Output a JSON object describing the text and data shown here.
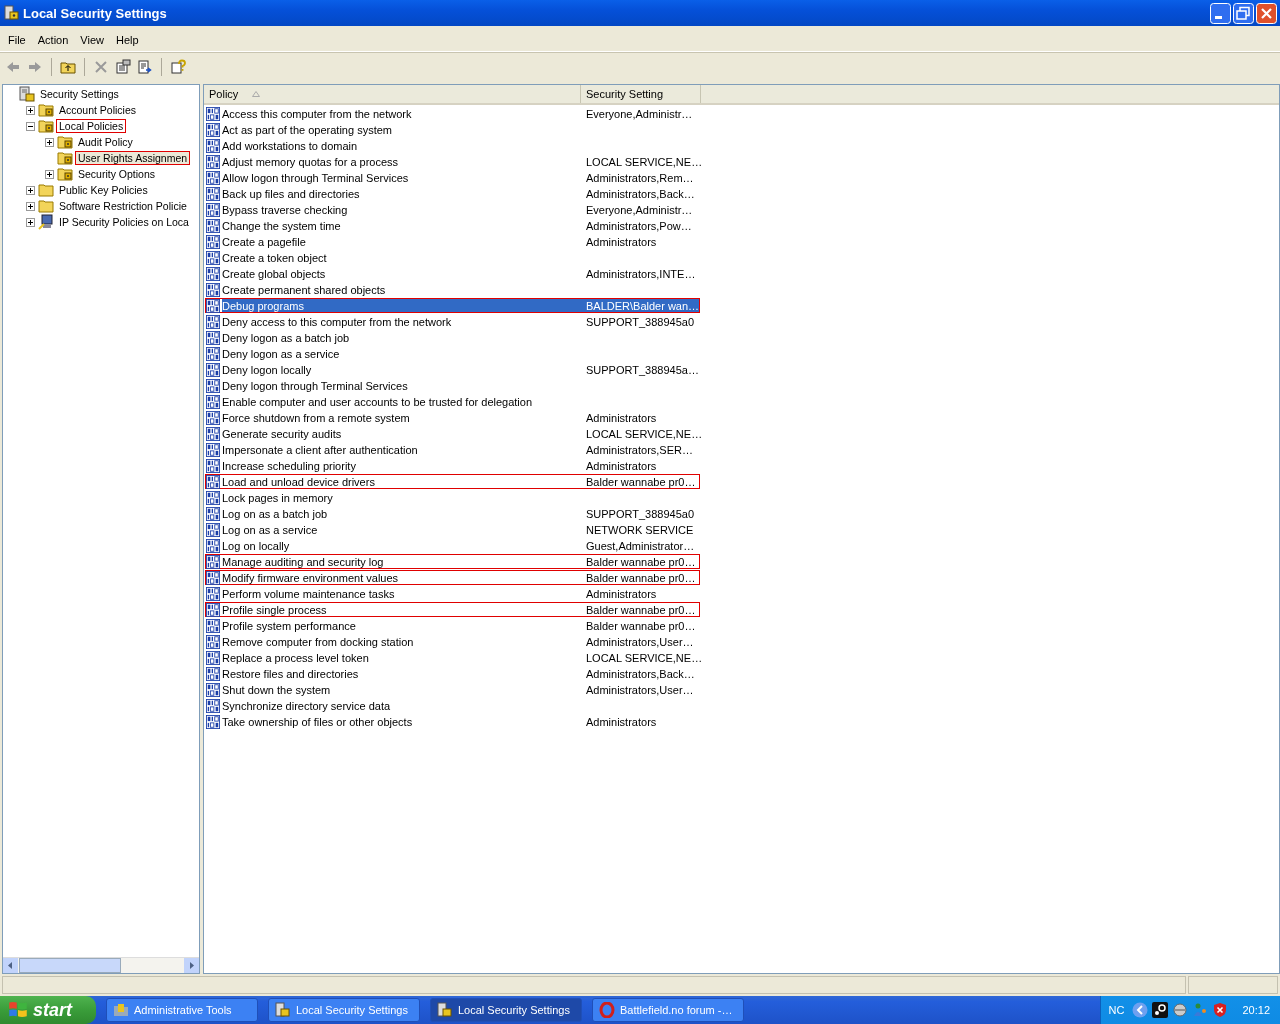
{
  "window": {
    "title": "Local Security Settings"
  },
  "menu": [
    "File",
    "Action",
    "View",
    "Help"
  ],
  "tree": [
    {
      "label": "Security Settings",
      "kind": "root",
      "selected": false,
      "highlighted": false,
      "children": [
        {
          "label": "Account Policies",
          "kind": "lock",
          "expanded": false,
          "selected": false,
          "highlighted": false
        },
        {
          "label": "Local Policies",
          "kind": "lock",
          "expanded": true,
          "selected": false,
          "highlighted": true,
          "children": [
            {
              "label": "Audit Policy",
              "kind": "lock",
              "expanded": false,
              "selected": false,
              "highlighted": false
            },
            {
              "label": "User Rights Assignmen",
              "kind": "lock",
              "selected": true,
              "highlighted": true
            },
            {
              "label": "Security Options",
              "kind": "lock",
              "expanded": false,
              "selected": false,
              "highlighted": false
            }
          ]
        },
        {
          "label": "Public Key Policies",
          "kind": "folder",
          "expanded": false,
          "selected": false,
          "highlighted": false
        },
        {
          "label": "Software Restriction Policie",
          "kind": "folder",
          "expanded": false,
          "selected": false,
          "highlighted": false
        },
        {
          "label": "IP Security Policies on Loca",
          "kind": "ip",
          "expanded": false,
          "selected": false,
          "highlighted": false
        }
      ]
    }
  ],
  "table": {
    "columns": [
      "Policy",
      "Security Setting"
    ],
    "rows": [
      {
        "policy": "Access this computer from the network",
        "setting": "Everyone,Administr…",
        "selected": false,
        "highlighted": false
      },
      {
        "policy": "Act as part of the operating system",
        "selected": false,
        "highlighted": false
      },
      {
        "policy": "Add workstations to domain",
        "selected": false,
        "highlighted": false
      },
      {
        "policy": "Adjust memory quotas for a process",
        "setting": "LOCAL SERVICE,NE…",
        "selected": false,
        "highlighted": false
      },
      {
        "policy": "Allow logon through Terminal Services",
        "setting": "Administrators,Rem…",
        "selected": false,
        "highlighted": false
      },
      {
        "policy": "Back up files and directories",
        "setting": "Administrators,Back…",
        "selected": false,
        "highlighted": false
      },
      {
        "policy": "Bypass traverse checking",
        "setting": "Everyone,Administr…",
        "selected": false,
        "highlighted": false
      },
      {
        "policy": "Change the system time",
        "setting": "Administrators,Pow…",
        "selected": false,
        "highlighted": false
      },
      {
        "policy": "Create a pagefile",
        "setting": "Administrators",
        "selected": false,
        "highlighted": false
      },
      {
        "policy": "Create a token object",
        "selected": false,
        "highlighted": false
      },
      {
        "policy": "Create global objects",
        "setting": "Administrators,INTE…",
        "selected": false,
        "highlighted": false
      },
      {
        "policy": "Create permanent shared objects",
        "selected": false,
        "highlighted": false
      },
      {
        "policy": "Debug programs",
        "setting": "BALDER\\Balder wan…",
        "selected": true,
        "highlighted": true
      },
      {
        "policy": "Deny access to this computer from the network",
        "setting": "SUPPORT_388945a0",
        "selected": false,
        "highlighted": false
      },
      {
        "policy": "Deny logon as a batch job",
        "selected": false,
        "highlighted": false
      },
      {
        "policy": "Deny logon as a service",
        "selected": false,
        "highlighted": false
      },
      {
        "policy": "Deny logon locally",
        "setting": "SUPPORT_388945a…",
        "selected": false,
        "highlighted": false
      },
      {
        "policy": "Deny logon through Terminal Services",
        "selected": false,
        "highlighted": false
      },
      {
        "policy": "Enable computer and user accounts to be trusted for delegation",
        "selected": false,
        "highlighted": false
      },
      {
        "policy": "Force shutdown from a remote system",
        "setting": "Administrators",
        "selected": false,
        "highlighted": false
      },
      {
        "policy": "Generate security audits",
        "setting": "LOCAL SERVICE,NE…",
        "selected": false,
        "highlighted": false
      },
      {
        "policy": "Impersonate a client after authentication",
        "setting": "Administrators,SER…",
        "selected": false,
        "highlighted": false
      },
      {
        "policy": "Increase scheduling priority",
        "setting": "Administrators",
        "selected": false,
        "highlighted": false
      },
      {
        "policy": "Load and unload device drivers",
        "setting": "Balder wannabe pr0…",
        "selected": false,
        "highlighted": true
      },
      {
        "policy": "Lock pages in memory",
        "selected": false,
        "highlighted": false
      },
      {
        "policy": "Log on as a batch job",
        "setting": "SUPPORT_388945a0",
        "selected": false,
        "highlighted": false
      },
      {
        "policy": "Log on as a service",
        "setting": "NETWORK SERVICE",
        "selected": false,
        "highlighted": false
      },
      {
        "policy": "Log on locally",
        "setting": "Guest,Administrator…",
        "selected": false,
        "highlighted": false
      },
      {
        "policy": "Manage auditing and security log",
        "setting": "Balder wannabe pr0…",
        "selected": false,
        "highlighted": true
      },
      {
        "policy": "Modify firmware environment values",
        "setting": "Balder wannabe pr0…",
        "selected": false,
        "highlighted": true
      },
      {
        "policy": "Perform volume maintenance tasks",
        "setting": "Administrators",
        "selected": false,
        "highlighted": false
      },
      {
        "policy": "Profile single process",
        "setting": "Balder wannabe pr0…",
        "selected": false,
        "highlighted": true
      },
      {
        "policy": "Profile system performance",
        "setting": "Balder wannabe pr0…",
        "selected": false,
        "highlighted": false
      },
      {
        "policy": "Remove computer from docking station",
        "setting": "Administrators,User…",
        "selected": false,
        "highlighted": false
      },
      {
        "policy": "Replace a process level token",
        "setting": "LOCAL SERVICE,NE…",
        "selected": false,
        "highlighted": false
      },
      {
        "policy": "Restore files and directories",
        "setting": "Administrators,Back…",
        "selected": false,
        "highlighted": false
      },
      {
        "policy": "Shut down the system",
        "setting": "Administrators,User…",
        "selected": false,
        "highlighted": false
      },
      {
        "policy": "Synchronize directory service data",
        "selected": false,
        "highlighted": false
      },
      {
        "policy": "Take ownership of files or other objects",
        "setting": "Administrators",
        "selected": false,
        "highlighted": false
      }
    ]
  },
  "taskbar": {
    "start": "start",
    "buttons": [
      {
        "label": "Administrative Tools",
        "kind": "tools",
        "selected": false
      },
      {
        "label": "Local Security Settings",
        "kind": "security",
        "selected": false
      },
      {
        "label": "Local Security Settings",
        "kind": "security",
        "selected": true
      },
      {
        "label": "Battlefield.no forum -…",
        "kind": "browser",
        "selected": false
      }
    ],
    "language": "NC",
    "clock": "20:12"
  }
}
